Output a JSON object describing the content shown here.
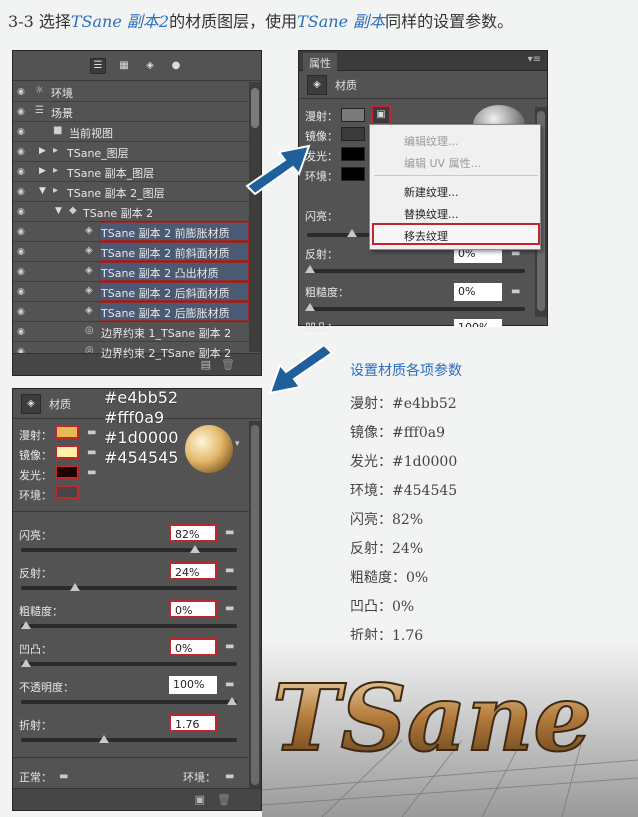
{
  "heading": {
    "prefix": "3-3 选择",
    "name1": "TSane 副本2",
    "mid": "的材质图层，使用",
    "name2": "TSane 副本",
    "suffix": "同样的设置参数。"
  },
  "layers": {
    "rows": [
      {
        "label": "环境",
        "icon": "environment-icon"
      },
      {
        "label": "场景",
        "icon": "scene-icon"
      },
      {
        "label": "当前视图",
        "icon": "camera-icon"
      },
      {
        "label": "TSane_图层",
        "icon": "folder-icon"
      },
      {
        "label": "TSane 副本_图层",
        "icon": "folder-icon"
      },
      {
        "label": "TSane 副本 2_图层",
        "icon": "folder-icon"
      },
      {
        "label": "TSane 副本 2",
        "icon": "mesh-icon"
      },
      {
        "label": "TSane 副本 2 前膨胀材质",
        "icon": "material-icon"
      },
      {
        "label": "TSane 副本 2 前斜面材质",
        "icon": "material-icon"
      },
      {
        "label": "TSane 副本 2 凸出材质",
        "icon": "material-icon"
      },
      {
        "label": "TSane 副本 2 后斜面材质",
        "icon": "material-icon"
      },
      {
        "label": "TSane 副本 2 后膨胀材质",
        "icon": "material-icon"
      },
      {
        "label": "边界约束 1_TSane 副本 2",
        "icon": "constraint-icon"
      },
      {
        "label": "边界约束 2_TSane 副本 2",
        "icon": "constraint-icon"
      }
    ]
  },
  "props_small": {
    "tab": "属性",
    "section": "材质",
    "labels": {
      "diffuse": "漫射：",
      "specular": "镜像：",
      "illum": "发光：",
      "ambient": "环境：",
      "shine": "闪亮：",
      "reflect": "反射：",
      "rough": "粗糙度：",
      "bump": "凹凸："
    },
    "reflect_value": "0%",
    "rough_value": "0%",
    "bump_value": "100%"
  },
  "context_menu": {
    "items": [
      "编辑纹理...",
      "编辑 UV 属性...",
      "新建纹理...",
      "替换纹理...",
      "移去纹理"
    ]
  },
  "props_big": {
    "section": "材质",
    "labels": {
      "diffuse": "漫射：",
      "specular": "镜像：",
      "illum": "发光：",
      "ambient": "环境：",
      "shine": "闪亮：",
      "reflect": "反射：",
      "rough": "粗糙度：",
      "bump": "凹凸：",
      "opacity": "不透明度：",
      "refraction": "折射：",
      "normal": "正常：",
      "environment": "环境："
    },
    "values": {
      "shine": "82%",
      "reflect": "24%",
      "rough": "0%",
      "bump": "0%",
      "opacity": "100%",
      "refraction": "1.76"
    },
    "colors": {
      "diffuse": "#e4bb52",
      "specular": "#fff0a9",
      "illum": "#1d0000",
      "ambient": "#454545"
    },
    "slider_levels": {
      "shine": 0.82,
      "reflect": 0.24,
      "rough": 0,
      "bump": 0,
      "opacity": 1,
      "refraction": 0.38
    }
  },
  "hex_labels": [
    "#e4bb52",
    "#fff0a9",
    "#1d0000",
    "#454545"
  ],
  "params": {
    "title": "设置材质各项参数",
    "lines": [
      "漫射：#e4bb52",
      "镜像：#fff0a9",
      "发光：#1d0000",
      "环境：#454545",
      "闪亮：82%",
      "反射：24%",
      "粗糙度：0%",
      "凹凸：0%",
      "折射：1.76"
    ]
  },
  "render": {
    "text": "TSane"
  }
}
